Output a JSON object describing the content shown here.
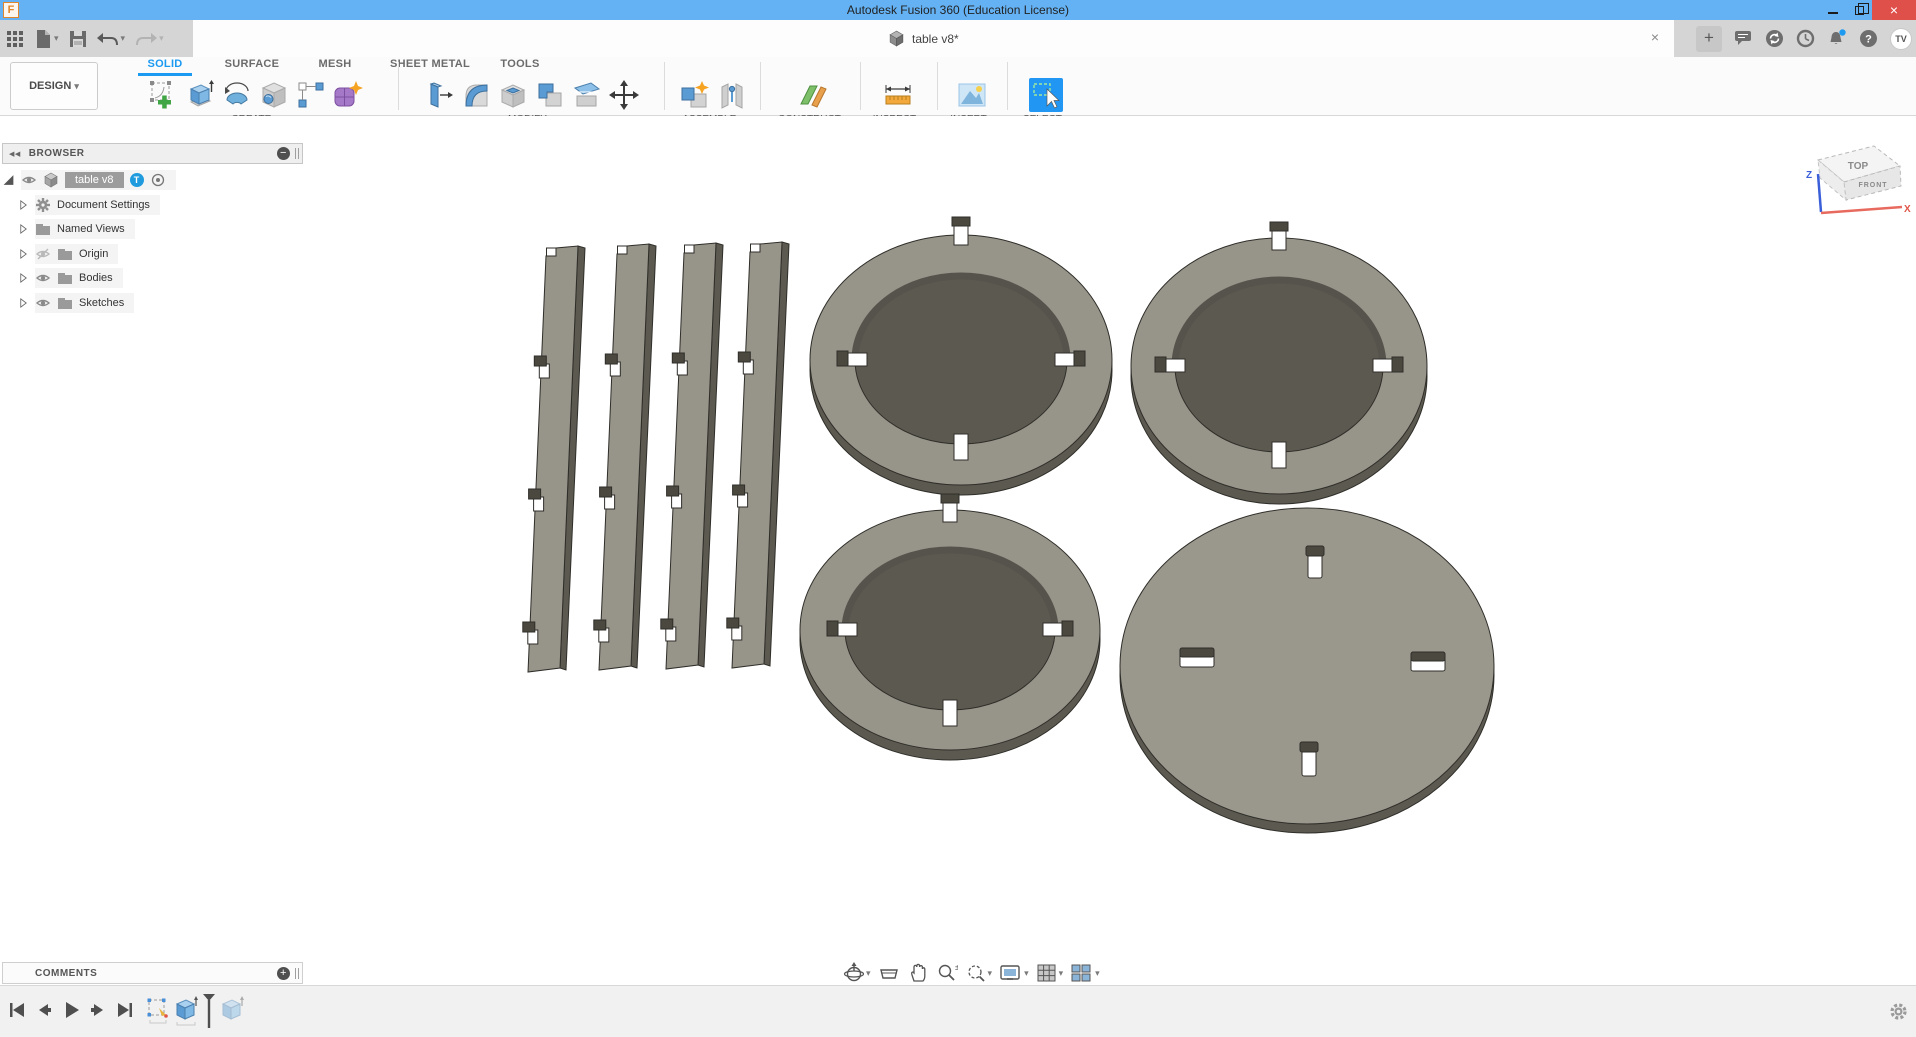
{
  "window": {
    "title": "Autodesk Fusion 360 (Education License)",
    "logo": "F"
  },
  "glyphs": {
    "caret": "▾",
    "close": "×",
    "plus": "+",
    "minus": "−",
    "collapse": "◀◀",
    "question": "?"
  },
  "tabbar": {
    "document": "table v8*",
    "avatar": "TV"
  },
  "ribbon": {
    "design": "DESIGN",
    "tabs": [
      {
        "label": "SOLID"
      },
      {
        "label": "SURFACE"
      },
      {
        "label": "MESH"
      },
      {
        "label": "SHEET METAL"
      },
      {
        "label": "TOOLS"
      }
    ],
    "active_tab": "SOLID",
    "groups": [
      {
        "label": "CREATE"
      },
      {
        "label": "MODIFY"
      },
      {
        "label": "ASSEMBLE"
      },
      {
        "label": "CONSTRUCT"
      },
      {
        "label": "INSPECT"
      },
      {
        "label": "INSERT"
      },
      {
        "label": "SELECT"
      }
    ]
  },
  "browser": {
    "header": "BROWSER",
    "root": "table v8",
    "badge": "T",
    "items": [
      {
        "label": "Document Settings"
      },
      {
        "label": "Named Views"
      },
      {
        "label": "Origin"
      },
      {
        "label": "Bodies"
      },
      {
        "label": "Sketches"
      }
    ]
  },
  "viewcube": {
    "top": "TOP",
    "front": "FRONT",
    "x": "X",
    "z": "Z"
  },
  "comments": {
    "header": "COMMENTS"
  },
  "canvas": {
    "description": "Flat-laid laser-cut table parts: 4 notched slat legs, 3 rings with 4 notches each, 1 circular top disc with 4 slots"
  },
  "colors": {
    "titlebar": "#64b2f4",
    "accent_blue": "#1b9af2",
    "close_red": "#e0504a",
    "part_face": "#97948a",
    "part_side": "#5c5a50",
    "select_bg": "#2196f3"
  }
}
